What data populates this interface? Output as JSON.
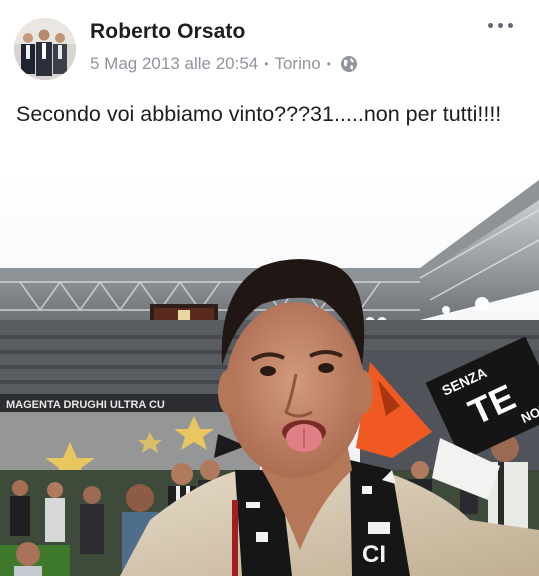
{
  "post": {
    "author": "Roberto Orsato",
    "date": "5 Mag 2013 alle 20:54",
    "location": "Torino",
    "visibility_icon": "globe-icon",
    "menu_icon": "more-options-icon",
    "text": "Secondo voi abbiamo vinto???31.....non per tutti!!!!"
  },
  "photo": {
    "banner_text": "MAGENTA    DRUGHI ULTRA    CU",
    "flag_text_1": "SENZA",
    "flag_text_2": "TE",
    "flag_text_3": "NON",
    "scarf_text": "CI"
  },
  "colors": {
    "text_primary": "#1c1e21",
    "text_secondary": "#90949c"
  }
}
